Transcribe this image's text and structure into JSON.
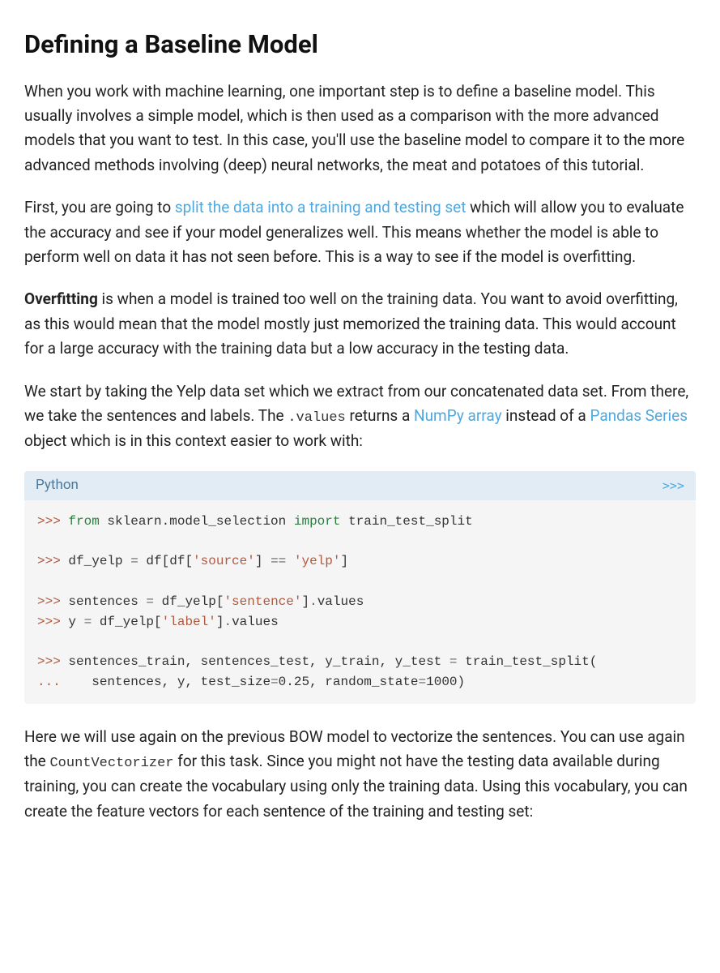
{
  "heading": "Defining a Baseline Model",
  "p1": "When you work with machine learning, one important step is to define a baseline model. This usually involves a simple model, which is then used as a comparison with the more advanced models that you want to test. In this case, you'll use the baseline model to compare it to the more advanced methods involving (deep) neural networks, the meat and potatoes of this tutorial.",
  "p2a": "First, you are going to ",
  "p2link": "split the data into a training and testing set",
  "p2b": " which will allow you to evaluate the accuracy and see if your model generalizes well. This means whether the model is able to perform well on data it has not seen before. This is a way to see if the model is overfitting.",
  "p3strong": "Overfitting",
  "p3rest": " is when a model is trained too well on the training data. You want to avoid overfitting, as this would mean that the model mostly just memorized the training data. This would account for a large accuracy with the training data but a low accuracy in the testing data.",
  "p4a": "We start by taking the Yelp data set which we extract from our concatenated data set. From there, we take the sentences and labels. The ",
  "p4code1": ".values",
  "p4b": " returns a ",
  "p4link1": "NumPy array",
  "p4c": " instead of a ",
  "p4link2": "Pandas Series",
  "p4d": " object which is in this context easier to work with:",
  "codeLang": "Python",
  "codeToggle": ">>>",
  "code": {
    "l1": {
      "prompt": ">>> ",
      "kw1": "from",
      "mod": " sklearn.model_selection ",
      "kw2": "import",
      "rest": " train_test_split"
    },
    "l2": {
      "prompt": ">>> ",
      "a": "df_yelp ",
      "op": "=",
      "b": " df[df[",
      "s1": "'source'",
      "c": "] ",
      "eq": "==",
      "d": " ",
      "s2": "'yelp'",
      "e": "]"
    },
    "l3": {
      "prompt": ">>> ",
      "a": "sentences ",
      "op": "=",
      "b": " df_yelp[",
      "s": "'sentence'",
      "c": "]",
      "dot": ".",
      "v": "values"
    },
    "l4": {
      "prompt": ">>> ",
      "a": "y ",
      "op": "=",
      "b": " df_yelp[",
      "s": "'label'",
      "c": "]",
      "dot": ".",
      "v": "values"
    },
    "l5": {
      "prompt": ">>> ",
      "a": "sentences_train, sentences_test, y_train, y_test ",
      "op": "=",
      "b": " train_test_split("
    },
    "l6": {
      "prompt": "...    ",
      "a": "sentences, y, test_size",
      "op1": "=",
      "n1": "0.25",
      "b": ", random_state",
      "op2": "=",
      "n2": "1000",
      "c": ")"
    }
  },
  "p5a": "Here we will use again on the previous BOW model to vectorize the sentences. You can use again the ",
  "p5code": "CountVectorizer",
  "p5b": " for this task. Since you might not have the testing data available during training, you can create the vocabulary using only the training data. Using this vocabulary, you can create the feature vectors for each sentence of the training and testing set:"
}
